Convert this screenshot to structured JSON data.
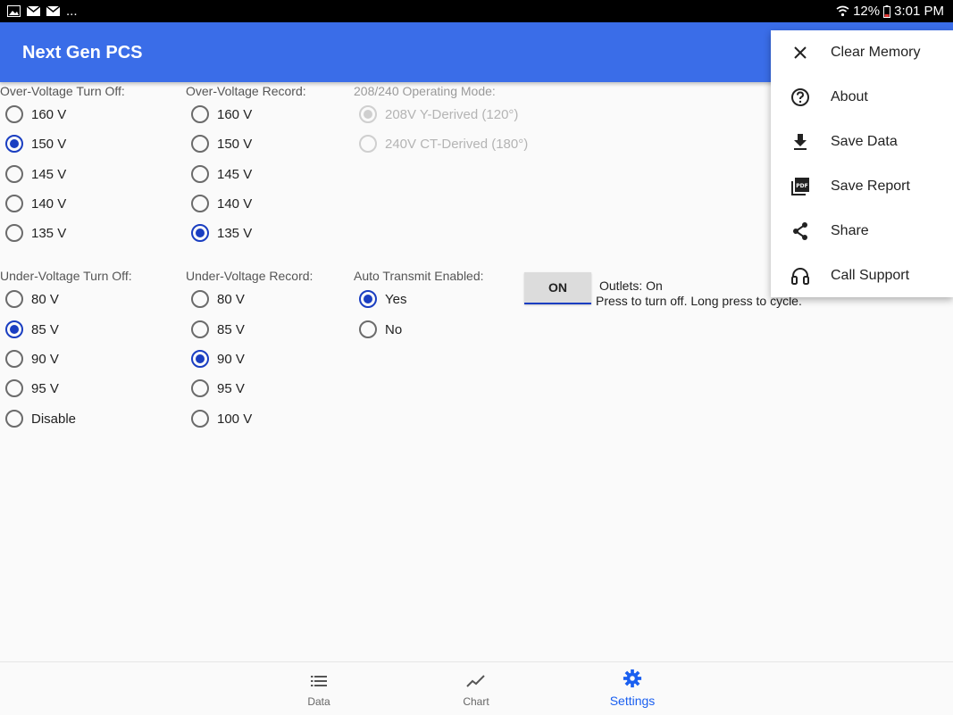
{
  "status_bar": {
    "notifications_more": "...",
    "battery": "12%",
    "time": "3:01 PM",
    "icons": [
      "image-icon",
      "gmail-icon",
      "gmail-icon",
      "wifi-icon",
      "battery-icon"
    ]
  },
  "app": {
    "title": "Next Gen PCS",
    "accent_color": "#3a6de8",
    "selected_color": "#1a3ec1"
  },
  "over_voltage_turn_off": {
    "label": "Over-Voltage Turn Off:",
    "options": [
      "160 V",
      "150 V",
      "145 V",
      "140 V",
      "135 V"
    ],
    "selected": "150 V"
  },
  "over_voltage_record": {
    "label": "Over-Voltage Record:",
    "options": [
      "160 V",
      "150 V",
      "145 V",
      "140 V",
      "135 V"
    ],
    "selected": "135 V"
  },
  "operating_mode": {
    "label": "208/240 Operating Mode:",
    "options": [
      "208V Y-Derived (120°)",
      "240V CT-Derived (180°)"
    ],
    "selected": "208V Y-Derived (120°)",
    "enabled": false
  },
  "under_voltage_turn_off": {
    "label": "Under-Voltage Turn Off:",
    "options": [
      "80 V",
      "85 V",
      "90 V",
      "95 V",
      "Disable"
    ],
    "selected": "85 V"
  },
  "under_voltage_record": {
    "label": "Under-Voltage Record:",
    "options": [
      "80 V",
      "85 V",
      "90 V",
      "95 V",
      "100 V"
    ],
    "selected": "90 V"
  },
  "auto_transmit": {
    "label": "Auto Transmit Enabled:",
    "options": [
      "Yes",
      "No"
    ],
    "selected": "Yes"
  },
  "outlets": {
    "button_label": "ON",
    "status": "Outlets: On",
    "hint": "Press to turn off. Long press to cycle."
  },
  "overflow_menu": {
    "items": [
      {
        "label": "Clear Memory",
        "icon": "close-icon"
      },
      {
        "label": "About",
        "icon": "help-circle-icon"
      },
      {
        "label": "Save Data",
        "icon": "download-icon"
      },
      {
        "label": "Save Report",
        "icon": "pdf-icon"
      },
      {
        "label": "Share",
        "icon": "share-icon"
      },
      {
        "label": "Call Support",
        "icon": "headset-icon"
      }
    ]
  },
  "bottom_nav": {
    "items": [
      {
        "label": "Data",
        "icon": "list-icon",
        "active": false
      },
      {
        "label": "Chart",
        "icon": "chart-line-icon",
        "active": false
      },
      {
        "label": "Settings",
        "icon": "gear-icon",
        "active": true
      }
    ]
  }
}
